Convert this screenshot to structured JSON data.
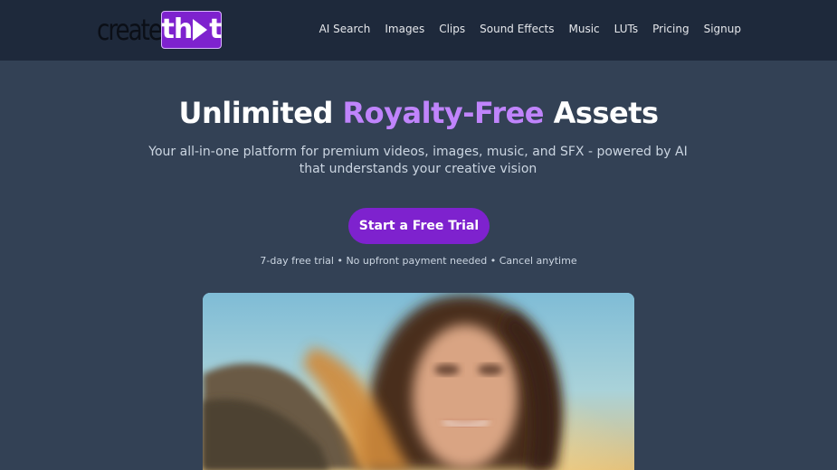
{
  "logo": {
    "part1": "create",
    "part2_left": "th",
    "part2_right": "t"
  },
  "nav": {
    "items": [
      {
        "label": "AI Search"
      },
      {
        "label": "Images"
      },
      {
        "label": "Clips"
      },
      {
        "label": "Sound Effects"
      },
      {
        "label": "Music"
      },
      {
        "label": "LUTs"
      },
      {
        "label": "Pricing"
      },
      {
        "label": "Signup"
      }
    ]
  },
  "hero": {
    "title_prefix": "Unlimited",
    "title_accent": "Royalty-Free",
    "title_suffix": "Assets",
    "subtitle": "Your all-in-one platform for premium videos, images, music, and SFX - powered by AI that understands your creative vision",
    "cta_label": "Start a Free Trial",
    "trial_note": "7-day free trial • No upfront payment needed • Cancel anytime"
  },
  "colors": {
    "page_bg": "#334155",
    "topbar_bg": "#1e293b",
    "accent": "#7e22ce",
    "accent_text": "#c084fc"
  }
}
